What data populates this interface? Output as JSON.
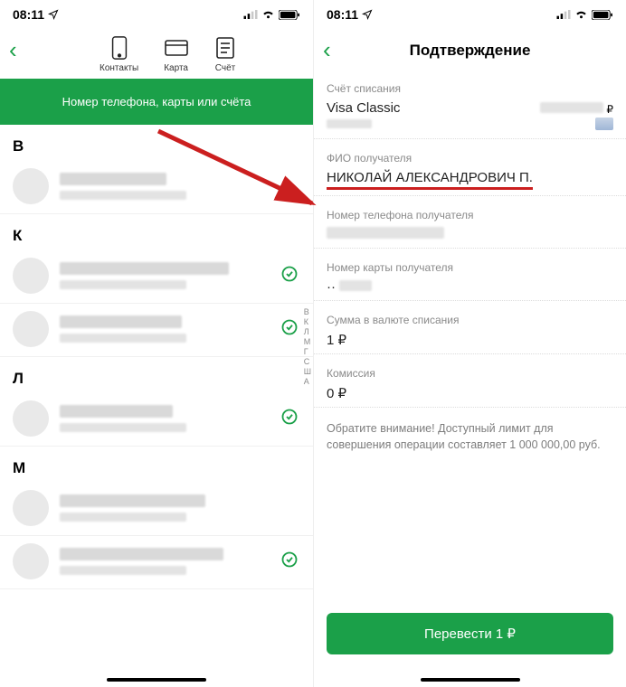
{
  "status": {
    "time": "08:11"
  },
  "left": {
    "methods": [
      {
        "label": "Контакты",
        "icon": "phone-icon"
      },
      {
        "label": "Карта",
        "icon": "card-icon"
      },
      {
        "label": "Счёт",
        "icon": "account-icon"
      }
    ],
    "banner": "Номер телефона, карты или счёта",
    "sections": [
      {
        "letter": "В",
        "items": [
          {
            "check": false
          }
        ]
      },
      {
        "letter": "К",
        "items": [
          {
            "check": true
          },
          {
            "check": true
          }
        ]
      },
      {
        "letter": "Л",
        "items": [
          {
            "check": true
          }
        ]
      },
      {
        "letter": "М",
        "items": [
          {
            "check": false
          },
          {
            "check": true
          }
        ]
      }
    ],
    "index_rail": [
      "В",
      "К",
      "Л",
      "М",
      "Г",
      "С",
      "Ш",
      "А"
    ]
  },
  "right": {
    "title": "Подтверждение",
    "account": {
      "label": "Счёт списания",
      "card_name": "Visa Classic"
    },
    "recipient_name": {
      "label": "ФИО получателя",
      "value": "НИКОЛАЙ АЛЕКСАНДРОВИЧ П."
    },
    "recipient_phone_label": "Номер телефона получателя",
    "recipient_card_label": "Номер карты получателя",
    "amount": {
      "label": "Сумма в валюте списания",
      "value": "1 ₽"
    },
    "fee": {
      "label": "Комиссия",
      "value": "0 ₽"
    },
    "notice": "Обратите внимание! Доступный лимит для совершения операции составляет 1 000 000,00 руб.",
    "button": "Перевести 1 ₽"
  }
}
